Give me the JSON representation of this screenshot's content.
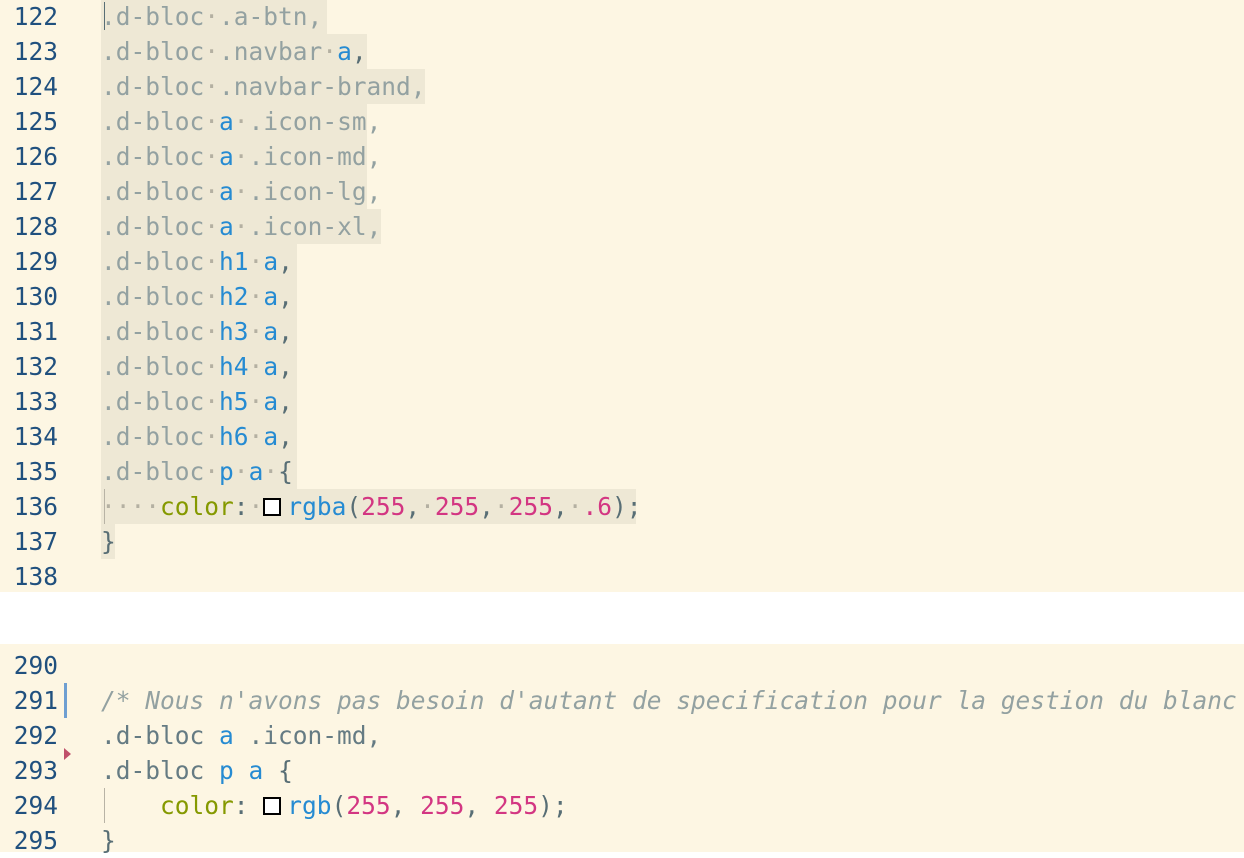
{
  "top_pane": {
    "lines": [
      {
        "num": "122",
        "parts": [
          {
            "t": ".d-bloc",
            "c": "sel-txt"
          },
          {
            "t": "·",
            "c": "dot"
          },
          {
            "t": ".a-btn,",
            "c": "sel-txt"
          }
        ]
      },
      {
        "num": "123",
        "parts": [
          {
            "t": ".d-bloc",
            "c": "sel-txt"
          },
          {
            "t": "·",
            "c": "dot"
          },
          {
            "t": ".navbar",
            "c": "sel-txt"
          },
          {
            "t": "·",
            "c": "dot"
          },
          {
            "t": "a",
            "c": "tag"
          },
          {
            "t": ",",
            "c": "punc"
          }
        ]
      },
      {
        "num": "124",
        "parts": [
          {
            "t": ".d-bloc",
            "c": "sel-txt"
          },
          {
            "t": "·",
            "c": "dot"
          },
          {
            "t": ".navbar-brand,",
            "c": "sel-txt"
          }
        ]
      },
      {
        "num": "125",
        "parts": [
          {
            "t": ".d-bloc",
            "c": "sel-txt"
          },
          {
            "t": "·",
            "c": "dot"
          },
          {
            "t": "a",
            "c": "tag"
          },
          {
            "t": "·",
            "c": "dot"
          },
          {
            "t": ".icon-sm,",
            "c": "sel-txt"
          }
        ]
      },
      {
        "num": "126",
        "parts": [
          {
            "t": ".d-bloc",
            "c": "sel-txt"
          },
          {
            "t": "·",
            "c": "dot"
          },
          {
            "t": "a",
            "c": "tag"
          },
          {
            "t": "·",
            "c": "dot"
          },
          {
            "t": ".icon-md,",
            "c": "sel-txt"
          }
        ]
      },
      {
        "num": "127",
        "parts": [
          {
            "t": ".d-bloc",
            "c": "sel-txt"
          },
          {
            "t": "·",
            "c": "dot"
          },
          {
            "t": "a",
            "c": "tag"
          },
          {
            "t": "·",
            "c": "dot"
          },
          {
            "t": ".icon-lg,",
            "c": "sel-txt"
          }
        ]
      },
      {
        "num": "128",
        "parts": [
          {
            "t": ".d-bloc",
            "c": "sel-txt"
          },
          {
            "t": "·",
            "c": "dot"
          },
          {
            "t": "a",
            "c": "tag"
          },
          {
            "t": "·",
            "c": "dot"
          },
          {
            "t": ".icon-xl,",
            "c": "sel-txt"
          }
        ]
      },
      {
        "num": "129",
        "parts": [
          {
            "t": ".d-bloc",
            "c": "sel-txt"
          },
          {
            "t": "·",
            "c": "dot"
          },
          {
            "t": "h1",
            "c": "tag"
          },
          {
            "t": "·",
            "c": "dot"
          },
          {
            "t": "a",
            "c": "tag"
          },
          {
            "t": ",",
            "c": "punc"
          }
        ]
      },
      {
        "num": "130",
        "parts": [
          {
            "t": ".d-bloc",
            "c": "sel-txt"
          },
          {
            "t": "·",
            "c": "dot"
          },
          {
            "t": "h2",
            "c": "tag"
          },
          {
            "t": "·",
            "c": "dot"
          },
          {
            "t": "a",
            "c": "tag"
          },
          {
            "t": ",",
            "c": "punc"
          }
        ]
      },
      {
        "num": "131",
        "parts": [
          {
            "t": ".d-bloc",
            "c": "sel-txt"
          },
          {
            "t": "·",
            "c": "dot"
          },
          {
            "t": "h3",
            "c": "tag"
          },
          {
            "t": "·",
            "c": "dot"
          },
          {
            "t": "a",
            "c": "tag"
          },
          {
            "t": ",",
            "c": "punc"
          }
        ]
      },
      {
        "num": "132",
        "parts": [
          {
            "t": ".d-bloc",
            "c": "sel-txt"
          },
          {
            "t": "·",
            "c": "dot"
          },
          {
            "t": "h4",
            "c": "tag"
          },
          {
            "t": "·",
            "c": "dot"
          },
          {
            "t": "a",
            "c": "tag"
          },
          {
            "t": ",",
            "c": "punc"
          }
        ]
      },
      {
        "num": "133",
        "parts": [
          {
            "t": ".d-bloc",
            "c": "sel-txt"
          },
          {
            "t": "·",
            "c": "dot"
          },
          {
            "t": "h5",
            "c": "tag"
          },
          {
            "t": "·",
            "c": "dot"
          },
          {
            "t": "a",
            "c": "tag"
          },
          {
            "t": ",",
            "c": "punc"
          }
        ]
      },
      {
        "num": "134",
        "parts": [
          {
            "t": ".d-bloc",
            "c": "sel-txt"
          },
          {
            "t": "·",
            "c": "dot"
          },
          {
            "t": "h6",
            "c": "tag"
          },
          {
            "t": "·",
            "c": "dot"
          },
          {
            "t": "a",
            "c": "tag"
          },
          {
            "t": ",",
            "c": "punc"
          }
        ]
      },
      {
        "num": "135",
        "parts": [
          {
            "t": ".d-bloc",
            "c": "sel-txt"
          },
          {
            "t": "·",
            "c": "dot"
          },
          {
            "t": "p",
            "c": "tag"
          },
          {
            "t": "·",
            "c": "dot"
          },
          {
            "t": "a",
            "c": "tag"
          },
          {
            "t": "·",
            "c": "dot"
          },
          {
            "t": "{",
            "c": "punc"
          }
        ]
      },
      {
        "num": "136",
        "parts": [
          {
            "t": "····",
            "c": "dot"
          },
          {
            "t": "color",
            "c": "prop"
          },
          {
            "t": ":",
            "c": "punc"
          },
          {
            "t": "·",
            "c": "dot"
          },
          {
            "t": "SWATCH",
            "c": "swatch"
          },
          {
            "t": "rgba",
            "c": "fn"
          },
          {
            "t": "(",
            "c": "punc"
          },
          {
            "t": "255",
            "c": "num"
          },
          {
            "t": ",",
            "c": "punc"
          },
          {
            "t": "·",
            "c": "dot"
          },
          {
            "t": "255",
            "c": "num"
          },
          {
            "t": ",",
            "c": "punc"
          },
          {
            "t": "·",
            "c": "dot"
          },
          {
            "t": "255",
            "c": "num"
          },
          {
            "t": ",",
            "c": "punc"
          },
          {
            "t": "·",
            "c": "dot"
          },
          {
            "t": ".6",
            "c": "num"
          },
          {
            "t": ");",
            "c": "punc"
          }
        ]
      },
      {
        "num": "137",
        "parts": [
          {
            "t": "}",
            "c": "punc"
          }
        ]
      },
      {
        "num": "138",
        "parts": []
      }
    ]
  },
  "bottom_pane": {
    "lines": [
      {
        "num": "290",
        "parts": []
      },
      {
        "num": "291",
        "parts": [
          {
            "t": "/* Nous n'avons pas besoin d'autant de specification pour la gestion du blanc */",
            "c": "cmt"
          }
        ]
      },
      {
        "num": "292",
        "parts": [
          {
            "t": ".d-bloc ",
            "c": "cls-dark"
          },
          {
            "t": "a",
            "c": "tag"
          },
          {
            "t": " .icon-md,",
            "c": "cls-dark"
          }
        ]
      },
      {
        "num": "293",
        "parts": [
          {
            "t": ".d-bloc ",
            "c": "cls-dark"
          },
          {
            "t": "p",
            "c": "tag"
          },
          {
            "t": " ",
            "c": "punc"
          },
          {
            "t": "a",
            "c": "tag"
          },
          {
            "t": " {",
            "c": "punc"
          }
        ]
      },
      {
        "num": "294",
        "parts": [
          {
            "t": "    ",
            "c": "punc"
          },
          {
            "t": "color",
            "c": "prop"
          },
          {
            "t": ": ",
            "c": "punc"
          },
          {
            "t": "SWATCH",
            "c": "swatch"
          },
          {
            "t": "rgb",
            "c": "fn"
          },
          {
            "t": "(",
            "c": "punc"
          },
          {
            "t": "255",
            "c": "num"
          },
          {
            "t": ", ",
            "c": "punc"
          },
          {
            "t": "255",
            "c": "num"
          },
          {
            "t": ", ",
            "c": "punc"
          },
          {
            "t": "255",
            "c": "num"
          },
          {
            "t": ");",
            "c": "punc"
          }
        ]
      },
      {
        "num": "295",
        "parts": [
          {
            "t": "}",
            "c": "punc"
          }
        ]
      }
    ]
  },
  "colors": {
    "background": "#fdf6e3",
    "selection": "#eee8d5",
    "line_number": "#20507e",
    "keyword_blue": "#268bd2",
    "property_green": "#859900",
    "number_magenta": "#d33682",
    "comment": "#93a1a1",
    "modified_marker": "#6f9fd1",
    "breakpoint_marker": "#c0506a"
  }
}
